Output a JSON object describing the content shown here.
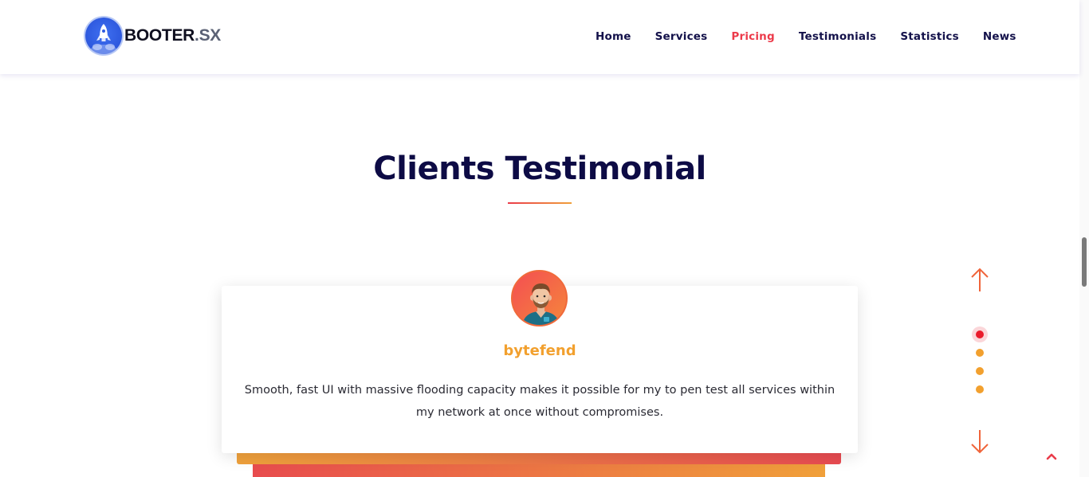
{
  "brand": {
    "name_part1": "BOOTER",
    "name_part2": ".SX"
  },
  "nav": {
    "items": [
      {
        "label": "Home",
        "active": false
      },
      {
        "label": "Services",
        "active": false
      },
      {
        "label": "Pricing",
        "active": true
      },
      {
        "label": "Testimonials",
        "active": false
      },
      {
        "label": "Statistics",
        "active": false
      },
      {
        "label": "News",
        "active": false
      }
    ]
  },
  "section": {
    "title": "Clients Testimonial"
  },
  "testimonial": {
    "name": "bytefend",
    "quote": "Smooth, fast UI with massive flooding capacity makes it possible for my to pen test all services within my network at once without compromises."
  },
  "slider": {
    "dot_count": 4,
    "active_index": 0
  },
  "icons": {
    "logo": "rocket-logo-icon",
    "up": "arrow-up-icon",
    "down": "arrow-down-icon",
    "top": "chevron-up-icon"
  },
  "colors": {
    "nav_text": "#13114a",
    "nav_active": "#ec3a4a",
    "title": "#0d0b45",
    "accent_orange": "#f2a02e",
    "accent_red": "#ea1c2c"
  }
}
